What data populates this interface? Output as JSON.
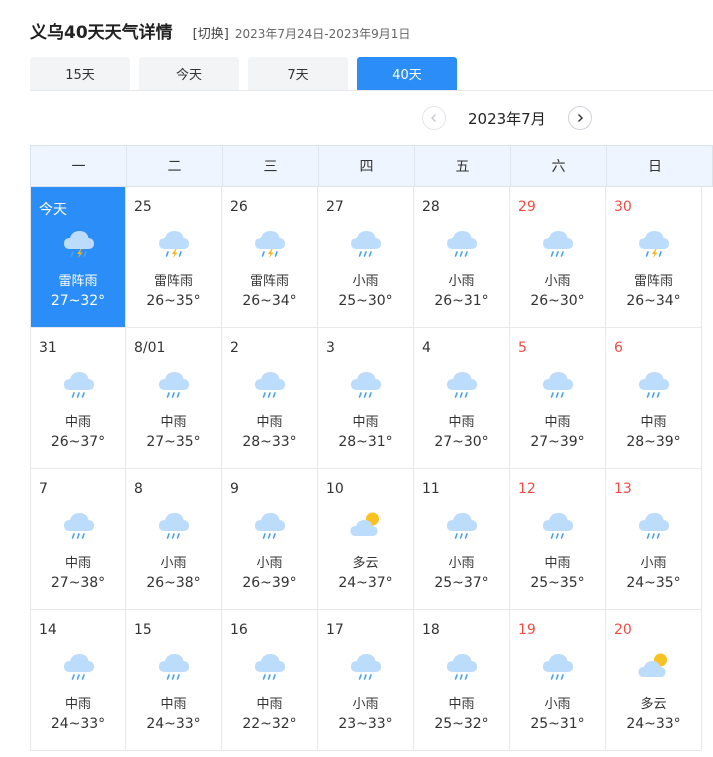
{
  "header": {
    "title": "义乌40天天气详情",
    "switch": "[切换]",
    "range": "2023年7月24日-2023年9月1日"
  },
  "tabs": [
    {
      "label": "15天",
      "active": false
    },
    {
      "label": "今天",
      "active": false
    },
    {
      "label": "7天",
      "active": false
    },
    {
      "label": "40天",
      "active": true
    }
  ],
  "month_nav": {
    "label": "2023年7月"
  },
  "weekdays": [
    "一",
    "二",
    "三",
    "四",
    "五",
    "六",
    "日"
  ],
  "colors": {
    "accent": "#2b8ef8",
    "weekend": "#f24b42"
  },
  "days": [
    {
      "date": "今天",
      "icon": "thunderstorm-icon",
      "cond": "雷阵雨",
      "temp": "27~32°",
      "today": true,
      "weekend": false
    },
    {
      "date": "25",
      "icon": "thunderstorm-icon",
      "cond": "雷阵雨",
      "temp": "26~35°",
      "weekend": false
    },
    {
      "date": "26",
      "icon": "thunderstorm-icon",
      "cond": "雷阵雨",
      "temp": "26~34°",
      "weekend": false
    },
    {
      "date": "27",
      "icon": "rain-icon",
      "cond": "小雨",
      "temp": "25~30°",
      "weekend": false
    },
    {
      "date": "28",
      "icon": "rain-icon",
      "cond": "小雨",
      "temp": "26~31°",
      "weekend": false
    },
    {
      "date": "29",
      "icon": "rain-icon",
      "cond": "小雨",
      "temp": "26~30°",
      "weekend": true
    },
    {
      "date": "30",
      "icon": "thunderstorm-icon",
      "cond": "雷阵雨",
      "temp": "26~34°",
      "weekend": true
    },
    {
      "date": "31",
      "icon": "rain-icon",
      "cond": "中雨",
      "temp": "26~37°",
      "weekend": false
    },
    {
      "date": "8/01",
      "icon": "rain-icon",
      "cond": "中雨",
      "temp": "27~35°",
      "weekend": false
    },
    {
      "date": "2",
      "icon": "rain-icon",
      "cond": "中雨",
      "temp": "28~33°",
      "weekend": false
    },
    {
      "date": "3",
      "icon": "rain-icon",
      "cond": "中雨",
      "temp": "28~31°",
      "weekend": false
    },
    {
      "date": "4",
      "icon": "rain-icon",
      "cond": "中雨",
      "temp": "27~30°",
      "weekend": false
    },
    {
      "date": "5",
      "icon": "rain-icon",
      "cond": "中雨",
      "temp": "27~39°",
      "weekend": true
    },
    {
      "date": "6",
      "icon": "rain-icon",
      "cond": "中雨",
      "temp": "28~39°",
      "weekend": true
    },
    {
      "date": "7",
      "icon": "rain-icon",
      "cond": "中雨",
      "temp": "27~38°",
      "weekend": false
    },
    {
      "date": "8",
      "icon": "rain-icon",
      "cond": "小雨",
      "temp": "26~38°",
      "weekend": false
    },
    {
      "date": "9",
      "icon": "rain-icon",
      "cond": "小雨",
      "temp": "26~39°",
      "weekend": false
    },
    {
      "date": "10",
      "icon": "partly-cloudy-icon",
      "cond": "多云",
      "temp": "24~37°",
      "weekend": false
    },
    {
      "date": "11",
      "icon": "rain-icon",
      "cond": "小雨",
      "temp": "25~37°",
      "weekend": false
    },
    {
      "date": "12",
      "icon": "rain-icon",
      "cond": "中雨",
      "temp": "25~35°",
      "weekend": true
    },
    {
      "date": "13",
      "icon": "rain-icon",
      "cond": "小雨",
      "temp": "24~35°",
      "weekend": true
    },
    {
      "date": "14",
      "icon": "rain-icon",
      "cond": "中雨",
      "temp": "24~33°",
      "weekend": false
    },
    {
      "date": "15",
      "icon": "rain-icon",
      "cond": "中雨",
      "temp": "24~33°",
      "weekend": false
    },
    {
      "date": "16",
      "icon": "rain-icon",
      "cond": "中雨",
      "temp": "22~32°",
      "weekend": false
    },
    {
      "date": "17",
      "icon": "rain-icon",
      "cond": "小雨",
      "temp": "23~33°",
      "weekend": false
    },
    {
      "date": "18",
      "icon": "rain-icon",
      "cond": "中雨",
      "temp": "25~32°",
      "weekend": false
    },
    {
      "date": "19",
      "icon": "rain-icon",
      "cond": "小雨",
      "temp": "25~31°",
      "weekend": true
    },
    {
      "date": "20",
      "icon": "partly-cloudy-icon",
      "cond": "多云",
      "temp": "24~33°",
      "weekend": true
    }
  ]
}
